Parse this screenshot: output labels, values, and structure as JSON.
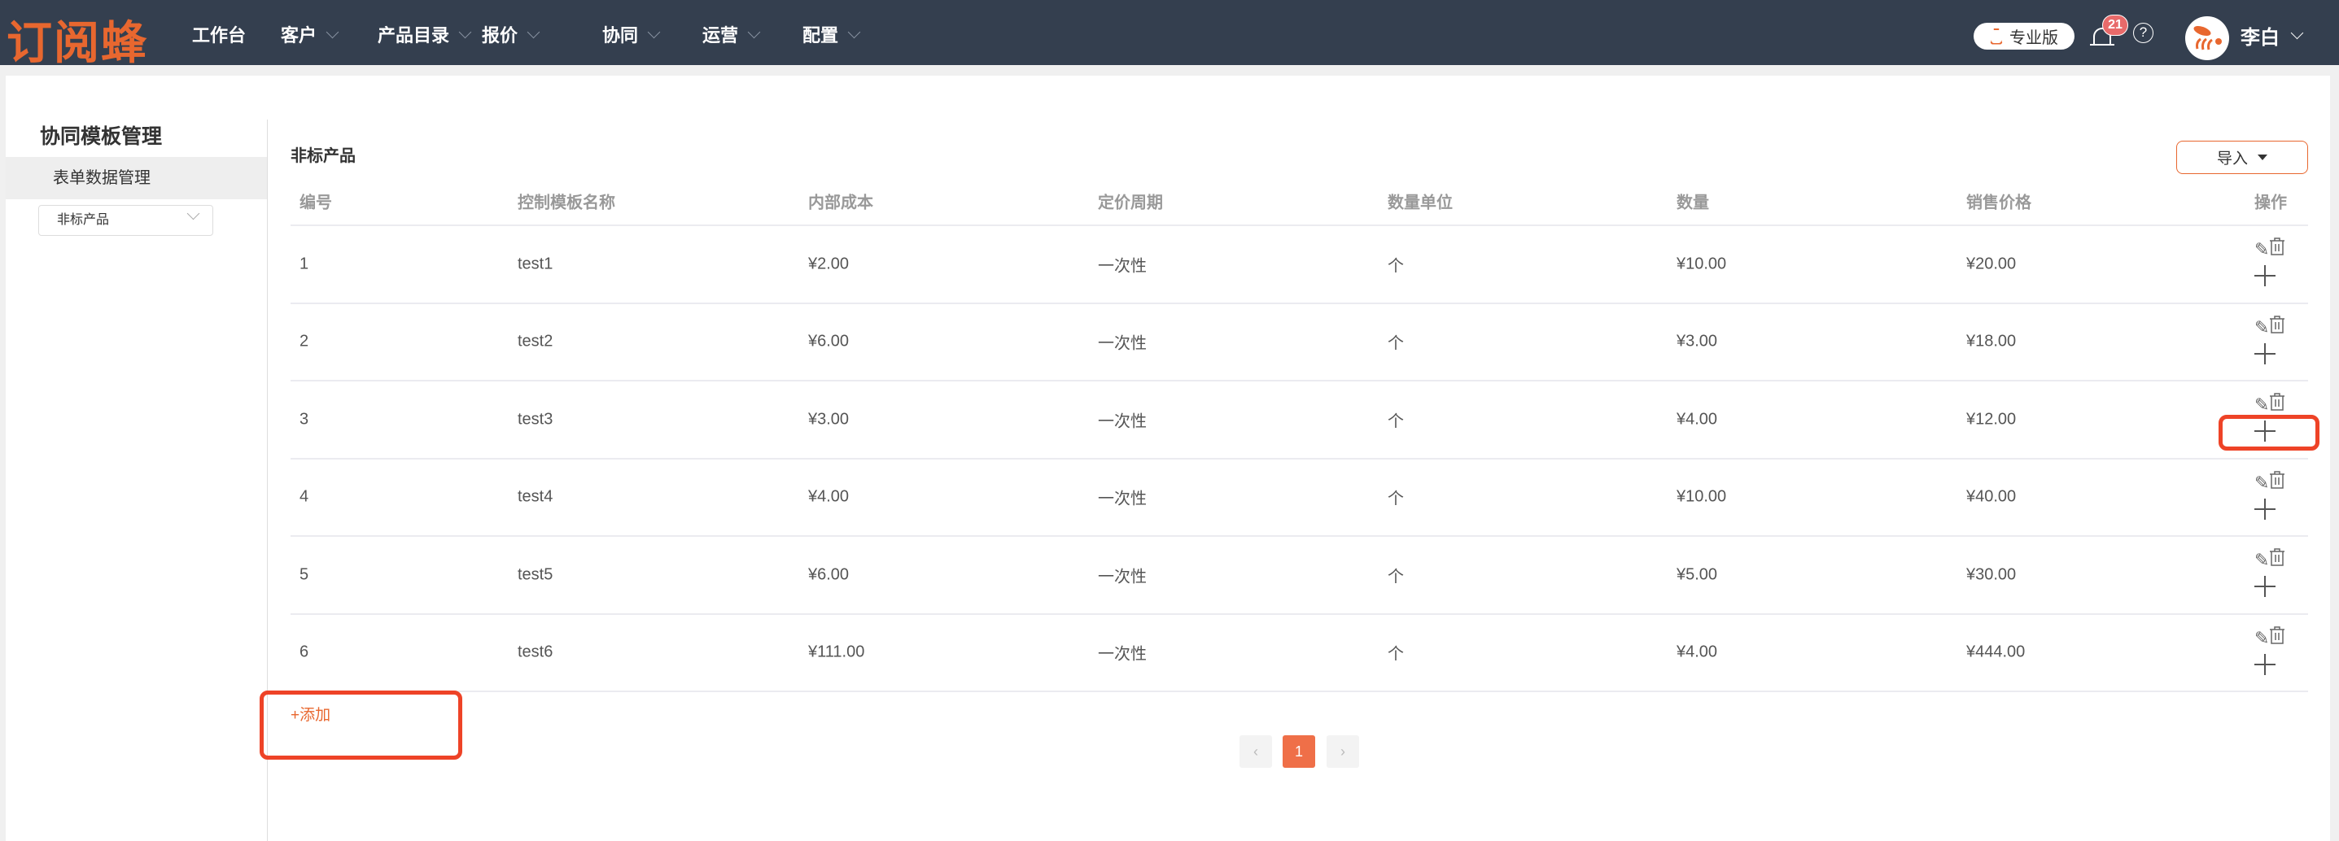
{
  "header": {
    "logo": "订阅蜂",
    "nav": [
      {
        "label": "工作台",
        "dropdown": false
      },
      {
        "label": "客户",
        "dropdown": true
      },
      {
        "label": "产品目录",
        "dropdown": true
      },
      {
        "label": "报价",
        "dropdown": true
      },
      {
        "label": "协同",
        "dropdown": true
      },
      {
        "label": "运营",
        "dropdown": true
      },
      {
        "label": "配置",
        "dropdown": true
      }
    ],
    "edition": "专业版",
    "notification_count": "21",
    "help": "?",
    "user": "李白"
  },
  "sidebar": {
    "title": "协同模板管理",
    "item": "表单数据管理",
    "select_value": "非标产品"
  },
  "main": {
    "title": "非标产品",
    "import_label": "导入",
    "columns": [
      "编号",
      "控制模板名称",
      "内部成本",
      "定价周期",
      "数量单位",
      "数量",
      "销售价格",
      "操作"
    ],
    "rows": [
      [
        "1",
        "test1",
        "¥2.00",
        "一次性",
        "个",
        "¥10.00",
        "¥20.00"
      ],
      [
        "2",
        "test2",
        "¥6.00",
        "一次性",
        "个",
        "¥3.00",
        "¥18.00"
      ],
      [
        "3",
        "test3",
        "¥3.00",
        "一次性",
        "个",
        "¥4.00",
        "¥12.00"
      ],
      [
        "4",
        "test4",
        "¥4.00",
        "一次性",
        "个",
        "¥10.00",
        "¥40.00"
      ],
      [
        "5",
        "test5",
        "¥6.00",
        "一次性",
        "个",
        "¥5.00",
        "¥30.00"
      ],
      [
        "6",
        "test6",
        "¥111.00",
        "一次性",
        "个",
        "¥4.00",
        "¥444.00"
      ]
    ],
    "add_label": "+添加",
    "pagination": {
      "prev": "‹",
      "current": "1",
      "next": "›"
    }
  },
  "colors": {
    "nav_bg": "#343f4f",
    "accent": "#e8672f",
    "annotation": "#ee4327"
  }
}
